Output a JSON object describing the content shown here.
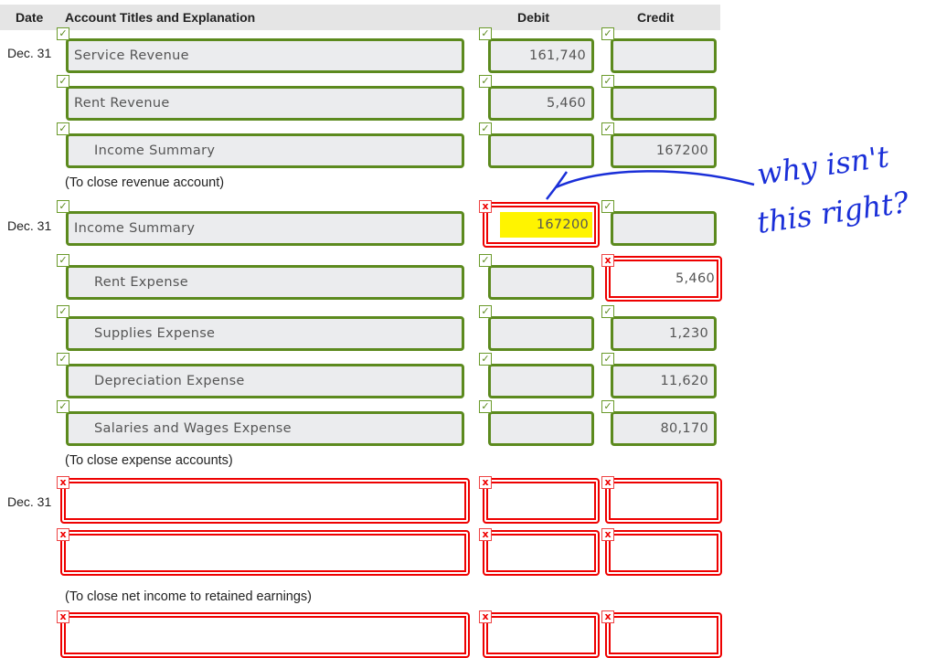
{
  "header": {
    "date": "Date",
    "account": "Account Titles and Explanation",
    "debit": "Debit",
    "credit": "Credit"
  },
  "entries": [
    {
      "date": "Dec. 31",
      "rows": [
        {
          "account": "Service Revenue",
          "indent": false,
          "account_status": "correct",
          "debit": "161,740",
          "debit_status": "correct",
          "credit": "",
          "credit_status": "correct"
        },
        {
          "account": "Rent Revenue",
          "indent": false,
          "account_status": "correct",
          "debit": "5,460",
          "debit_status": "correct",
          "credit": "",
          "credit_status": "correct"
        },
        {
          "account": "Income Summary",
          "indent": true,
          "account_status": "correct",
          "debit": "",
          "debit_status": "correct",
          "credit": "167200",
          "credit_status": "correct"
        }
      ],
      "note": "(To close revenue account)"
    },
    {
      "date": "Dec. 31",
      "rows": [
        {
          "account": "Income Summary",
          "indent": false,
          "account_status": "correct",
          "debit": "167200",
          "debit_status": "incorrect",
          "debit_highlight": true,
          "credit": "",
          "credit_status": "correct"
        },
        {
          "account": "Rent Expense",
          "indent": true,
          "account_status": "correct",
          "debit": "",
          "debit_status": "correct",
          "credit": "5,460",
          "credit_status": "incorrect"
        },
        {
          "account": "Supplies Expense",
          "indent": true,
          "account_status": "correct",
          "debit": "",
          "debit_status": "correct",
          "credit": "1,230",
          "credit_status": "correct"
        },
        {
          "account": "Depreciation Expense",
          "indent": true,
          "account_status": "correct",
          "debit": "",
          "debit_status": "correct",
          "credit": "11,620",
          "credit_status": "correct"
        },
        {
          "account": "Salaries and Wages Expense",
          "indent": true,
          "account_status": "correct",
          "debit": "",
          "debit_status": "correct",
          "credit": "80,170",
          "credit_status": "correct"
        }
      ],
      "note": "(To close expense accounts)"
    },
    {
      "date": "Dec. 31",
      "rows": [
        {
          "account": "",
          "account_status": "incorrect",
          "debit": "",
          "debit_status": "incorrect",
          "credit": "",
          "credit_status": "incorrect"
        },
        {
          "account": "",
          "account_status": "incorrect",
          "debit": "",
          "debit_status": "incorrect",
          "credit": "",
          "credit_status": "incorrect"
        }
      ],
      "note": "(To close net income to retained earnings)"
    },
    {
      "date": "",
      "rows": [
        {
          "account": "",
          "account_status": "incorrect",
          "debit": "",
          "debit_status": "incorrect",
          "credit": "",
          "credit_status": "incorrect"
        }
      ],
      "note": ""
    }
  ],
  "annotation": {
    "line1": "why isn't",
    "line2": "this right?",
    "color": "#1a2fd8"
  },
  "colors": {
    "correct": "#5c8a1e",
    "incorrect": "#e00000",
    "highlight": "#fff400"
  }
}
